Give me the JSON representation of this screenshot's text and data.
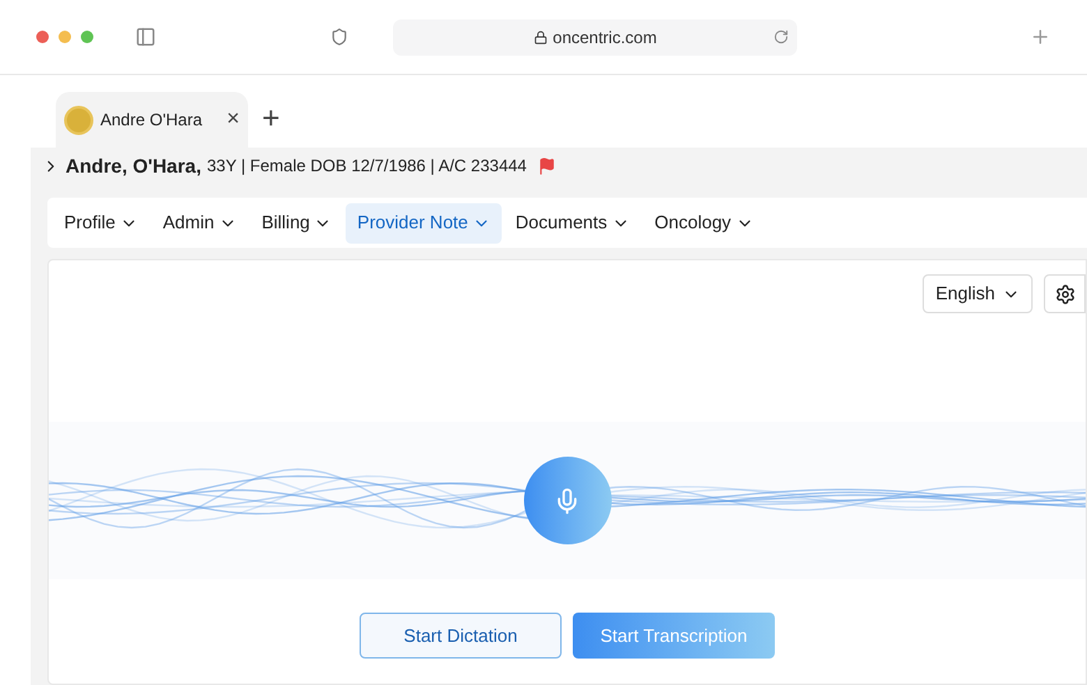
{
  "browser": {
    "url": "oncentric.com"
  },
  "tab": {
    "title": "Andre O'Hara",
    "close": "×",
    "add": "+"
  },
  "patient": {
    "name": "Andre, O'Hara,",
    "details": "33Y | Female DOB 12/7/1986 | A/C 233444",
    "flagged": true
  },
  "nav": [
    {
      "label": "Profile",
      "selected": false
    },
    {
      "label": "Admin",
      "selected": false
    },
    {
      "label": "Billing",
      "selected": false
    },
    {
      "label": "Provider Note",
      "selected": true
    },
    {
      "label": "Documents",
      "selected": false
    },
    {
      "label": "Oncology",
      "selected": false
    }
  ],
  "language": "English",
  "buttons": [
    {
      "label": "Start Dictation",
      "kind": "outline"
    },
    {
      "label": "Start Transcription",
      "kind": "primary"
    }
  ]
}
